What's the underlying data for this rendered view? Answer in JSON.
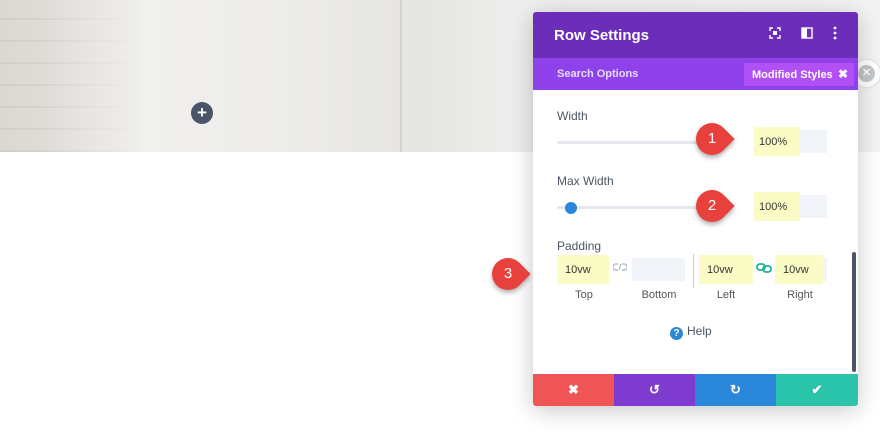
{
  "background": {
    "add_label": "+"
  },
  "modal": {
    "title": "Row Settings",
    "header_icons": [
      "expand-icon",
      "split-view-icon",
      "more-vertical-icon"
    ],
    "search_placeholder": "Search Options",
    "modified_label": "Modified Styles",
    "modified_close": "✖",
    "width": {
      "label": "Width",
      "value": "100%",
      "callout": "1"
    },
    "max_width": {
      "label": "Max Width",
      "value": "100%",
      "slider_position": 0.05,
      "callout": "2"
    },
    "padding": {
      "label": "Padding",
      "top": "10vw",
      "bottom": "",
      "left": "10vw",
      "right": "10vw",
      "labels": {
        "top": "Top",
        "bottom": "Bottom",
        "left": "Left",
        "right": "Right"
      },
      "callout": "3"
    },
    "help_label": "Help",
    "footer": {
      "cancel": "✖",
      "undo": "↺",
      "redo": "↻",
      "save": "✔"
    }
  },
  "colors": {
    "header": "#6c2eb9",
    "subbar": "#8f42ec",
    "cancel": "#ef5555",
    "undo": "#7e3bd0",
    "redo": "#2b87da",
    "save": "#29c4a9",
    "callout": "#e8403c",
    "highlight": "#fbfbc5"
  }
}
